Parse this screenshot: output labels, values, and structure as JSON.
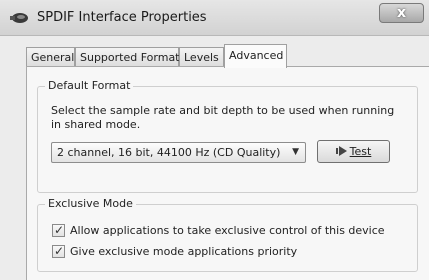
{
  "window": {
    "title": "SPDIF Interface Properties",
    "close_glyph": "x",
    "icon": "speaker-icon"
  },
  "tabs": [
    {
      "label": "General",
      "active": false
    },
    {
      "label": "Supported Formats",
      "active": false
    },
    {
      "label": "Levels",
      "active": false
    },
    {
      "label": "Advanced",
      "active": true
    }
  ],
  "default_format": {
    "title": "Default Format",
    "description_line1": "Select the sample rate and bit depth to be used when running",
    "description_line2": "in shared mode.",
    "selected_format": "2 channel, 16 bit, 44100 Hz (CD Quality)",
    "test_button_label": "Test"
  },
  "exclusive_mode": {
    "title": "Exclusive Mode",
    "options": [
      {
        "label": "Allow applications to take exclusive control of this device",
        "checked": true
      },
      {
        "label": "Give exclusive mode applications priority",
        "checked": true
      }
    ]
  }
}
